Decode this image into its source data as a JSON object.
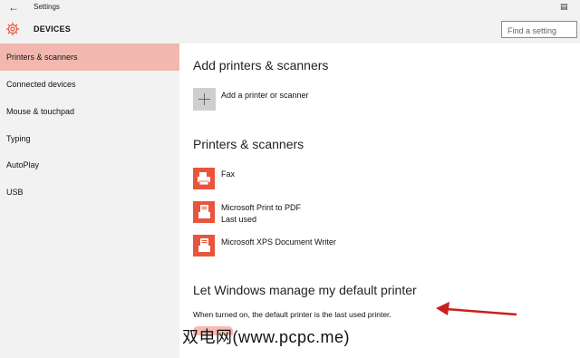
{
  "window": {
    "title": "Settings",
    "section": "DEVICES"
  },
  "search": {
    "placeholder": "Find a setting"
  },
  "sidebar": {
    "items": [
      {
        "label": "Printers & scanners",
        "selected": true
      },
      {
        "label": "Connected devices"
      },
      {
        "label": "Mouse & touchpad"
      },
      {
        "label": "Typing"
      },
      {
        "label": "AutoPlay"
      },
      {
        "label": "USB"
      }
    ]
  },
  "main": {
    "add_heading": "Add printers & scanners",
    "add_label": "Add a printer or scanner",
    "printers_heading": "Printers & scanners",
    "printers": [
      {
        "name": "Fax",
        "status": "",
        "icon": "fax-icon"
      },
      {
        "name": "Microsoft Print to PDF",
        "status": "Last used",
        "icon": "document-printer-icon"
      },
      {
        "name": "Microsoft XPS Document Writer",
        "status": "",
        "icon": "document-printer-icon"
      }
    ],
    "default_heading": "Let Windows manage my default printer",
    "default_desc": "When turned on, the default printer is the last used printer."
  },
  "watermark": "双电网(www.pcpc.me)",
  "colors": {
    "accent": "#e8553c",
    "selected_nav": "#f2b8b0",
    "arrow": "#c8201c"
  }
}
